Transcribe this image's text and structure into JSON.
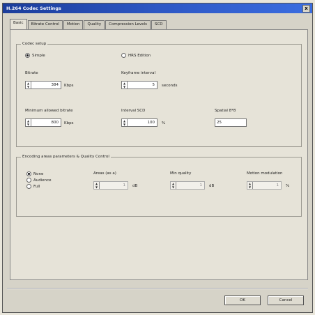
{
  "window": {
    "title": "H.264 Codec Settings",
    "close_glyph": "x"
  },
  "tabs": [
    {
      "label": "Basic"
    },
    {
      "label": "Bitrate Control"
    },
    {
      "label": "Motion"
    },
    {
      "label": "Quality"
    },
    {
      "label": "Compression Levels"
    },
    {
      "label": "SCD"
    }
  ],
  "codec_group": {
    "title": "Codec setup",
    "radio_a": "Simple",
    "radio_b": "HRS Edition",
    "bitrate": {
      "label": "Bitrate",
      "value": "384",
      "unit": "Kbps"
    },
    "keyframe": {
      "label": "Keyframe interval",
      "value": "5",
      "unit": "seconds"
    },
    "min_bitrate": {
      "label": "Minimum allowed bitrate",
      "value": "800",
      "unit": "Kbps"
    },
    "interval": {
      "label": "Interval SCD",
      "value": "100",
      "unit": "%"
    },
    "spatial": {
      "label": "Spatial 8*8",
      "value": "25"
    }
  },
  "encoding_group": {
    "title": "Encoding areas parameters & Quality Control",
    "radio_a": "None",
    "radio_b": "Audience",
    "radio_c": "Full",
    "field1": {
      "label": "Areas (as a)",
      "value": "1",
      "unit": "dB"
    },
    "field2": {
      "label": "Min quality",
      "value": "1",
      "unit": "dB"
    },
    "field3": {
      "label": "Motion modulation",
      "value": "1",
      "unit": "%"
    }
  },
  "buttons": {
    "ok": "OK",
    "cancel": "Cancel"
  }
}
